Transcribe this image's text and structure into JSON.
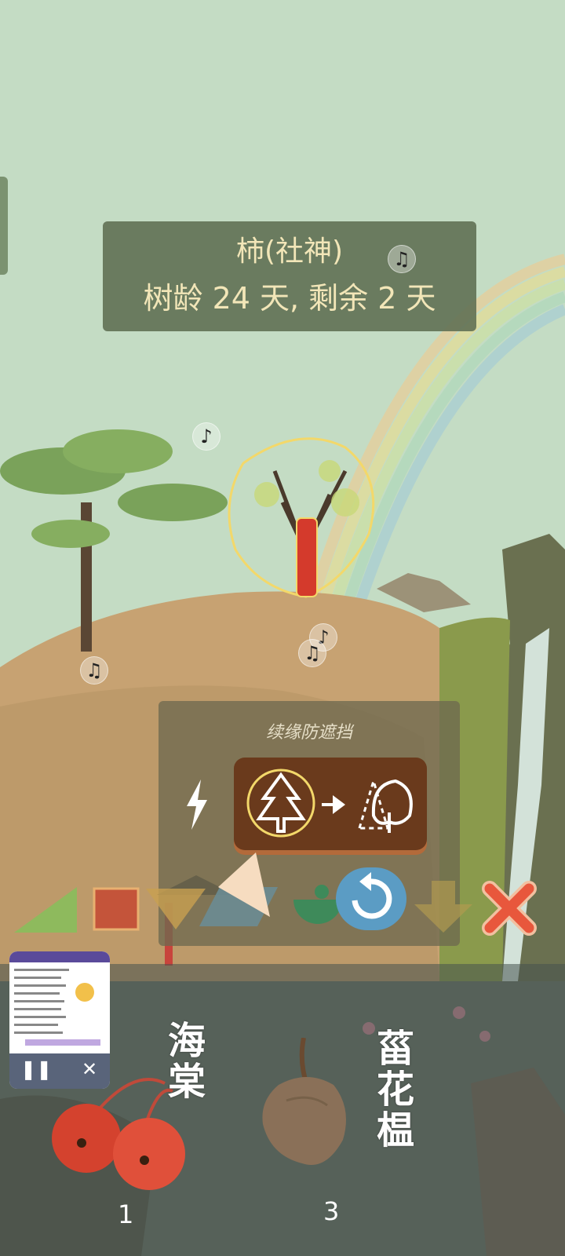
{
  "tree_info": {
    "name": "柿(社神)",
    "age_line": "树龄 24 天, 剩余 2 天"
  },
  "overlay": {
    "title": "续缘防遮挡"
  },
  "inventory": [
    {
      "label": "海棠",
      "count": "1"
    },
    {
      "label": "菑花榅",
      "count": "3"
    }
  ],
  "icons": {
    "music": "music-note-icon",
    "lightning": "lightning-icon",
    "swap": "tree-swap-icon",
    "reset": "reset-icon",
    "close": "close-icon",
    "pause": "pause-icon"
  },
  "colors": {
    "panel": "#607054",
    "text_gold": "#f2e6b8",
    "close_red": "#e8573c",
    "reset_blue": "#5b9cc4"
  }
}
